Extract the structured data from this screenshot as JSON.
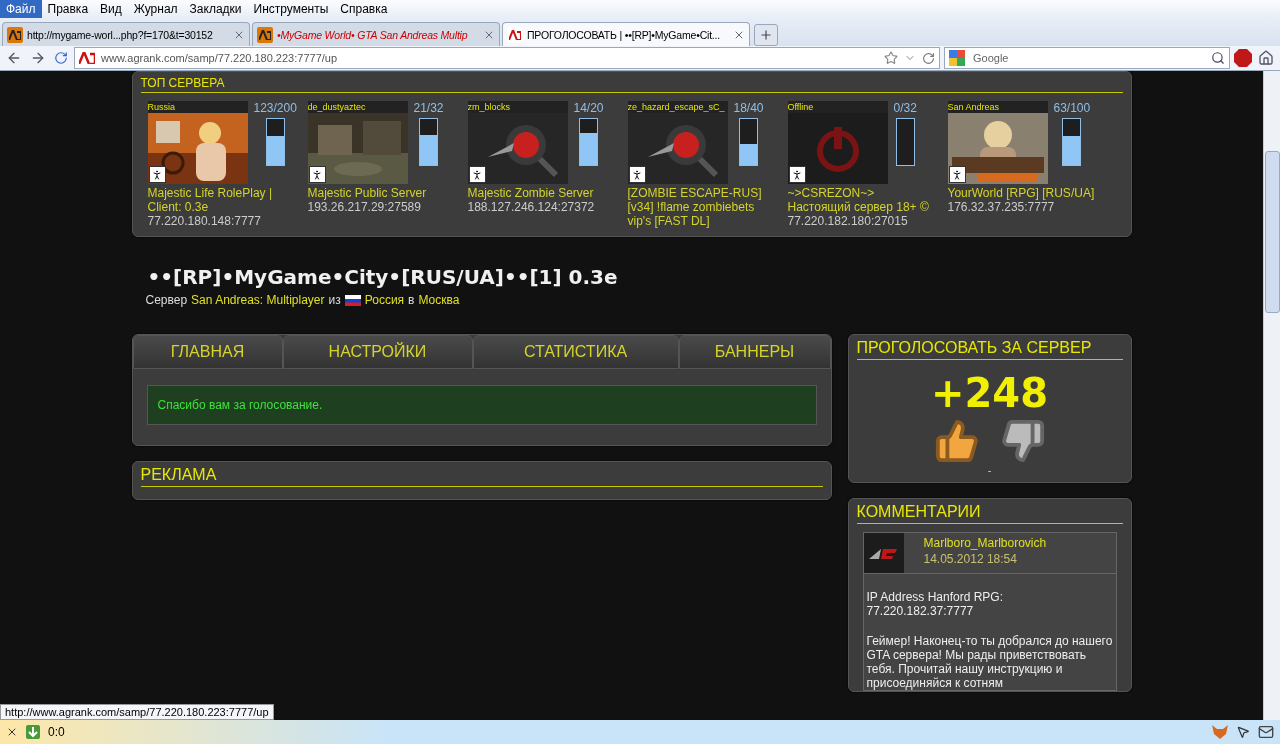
{
  "browser": {
    "menu": [
      {
        "label": "Файл",
        "selected": true
      },
      {
        "label": "Правка",
        "selected": false
      },
      {
        "label": "Вид",
        "selected": false
      },
      {
        "label": "Журнал",
        "selected": false
      },
      {
        "label": "Закладки",
        "selected": false
      },
      {
        "label": "Инструменты",
        "selected": false
      },
      {
        "label": "Справка",
        "selected": false
      }
    ],
    "tabs": [
      {
        "title": "http://mygame-worl...php?f=170&t=30152",
        "selected": false,
        "color": "#000000"
      },
      {
        "title": "•MyGame World• GTA San Andreas Multip",
        "selected": false,
        "color": "#cc0000"
      },
      {
        "title": "ПРОГОЛОСОВАТЬ | ••[RP]•MyGame•Cit...",
        "selected": true,
        "color": "#000000"
      }
    ],
    "url": "www.agrank.com/samp/77.220.180.223:7777/up",
    "search": {
      "placeholder": "Google"
    }
  },
  "top_servers": {
    "title": "ТОП СЕРВЕРА",
    "servers": [
      {
        "label": "Russia",
        "players": "123/200",
        "level": 0.62,
        "name": "Majestic Life RolePlay | Client: 0.3e",
        "address": "77.220.180.148:7777"
      },
      {
        "label": "de_dustyaztec",
        "players": "21/32",
        "level": 0.66,
        "name": "Majestic Public Server",
        "address": "193.26.217.29:27589"
      },
      {
        "label": "zm_blocks",
        "players": "14/20",
        "level": 0.7,
        "name": "Majestic Zombie Server",
        "address": "188.127.246.124:27372"
      },
      {
        "label": "ze_hazard_escape_sC_",
        "players": "18/40",
        "level": 0.45,
        "name": "[ZOMBIE ESCAPE-RUS] [v34] !flame zombiebets vip's [FAST DL]"
      },
      {
        "label": "Offline",
        "players": "0/32",
        "level": 0,
        "name": "~>CSREZON~> Настоящий сервер 18+ ©",
        "address": "77.220.182.180:27015"
      },
      {
        "label": "San Andreas",
        "players": "63/100",
        "level": 0.63,
        "name": "YourWorld [RPG] [RUS/UA]",
        "address": "176.32.37.235:7777"
      }
    ]
  },
  "server": {
    "title": "••[RP]•MyGame•City•[RUS/UA]••[1] 0.3e",
    "subtitle": {
      "prefix": "Сервер",
      "game": "San Andreas: Multiplayer",
      "from": "из",
      "country": "Россия",
      "in": "в",
      "city": "Москва"
    }
  },
  "tabs": [
    {
      "label": "ГЛАВНАЯ"
    },
    {
      "label": "НАСТРОЙКИ"
    },
    {
      "label": "СТАТИСТИКА"
    },
    {
      "label": "БАННЕРЫ"
    }
  ],
  "message": "Спасибо вам за голосование.",
  "ads": {
    "title": "РЕКЛАМА"
  },
  "vote": {
    "title": "ПРОГОЛОСОВАТЬ ЗА СЕРВЕР",
    "score": "+248",
    "note": "-"
  },
  "comments": {
    "title": "КОММЕНТАРИИ",
    "items": [
      {
        "author": "Marlboro_Marlborovich",
        "date": "14.05.2012 18:54",
        "paragraphs": [
          "IP Address Hanford RPG:\n77.220.182.37:7777",
          "Геймер! Наконец-то ты добрался до нашего GTA сервера! Мы рады приветствовать тебя. Прочитай нашу инструкцию и присоединяйся к сотням"
        ]
      }
    ]
  },
  "status": {
    "link": "http://www.agrank.com/samp/77.220.180.223:7777/up",
    "counter": "0:0"
  }
}
